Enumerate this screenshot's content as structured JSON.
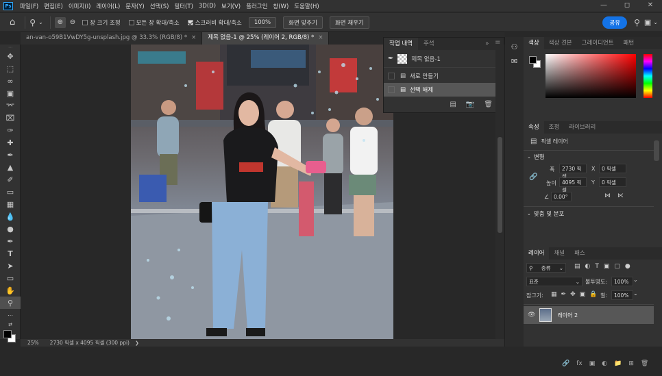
{
  "menu": {
    "app_logo": "Ps",
    "items": [
      "파일(F)",
      "편집(E)",
      "이미지(I)",
      "레이어(L)",
      "문자(Y)",
      "선택(S)",
      "필터(T)",
      "3D(D)",
      "보기(V)",
      "플러그인",
      "창(W)",
      "도움말(H)"
    ]
  },
  "options": {
    "zoom_fit": "창 크기 조정",
    "all_windows": "모든 창 확대/축소",
    "scrubby": "스크러비 확대/축소",
    "zoom_value": "100%",
    "fit_screen": "화면 맞추기",
    "fill_screen": "화면 채우기",
    "share": "공유"
  },
  "tabs": [
    {
      "label": "an-van-o59B1VwDY5g-unsplash.jpg @ 33.3% (RGB/8) *",
      "active": false
    },
    {
      "label": "제목 없음-1 @ 25% (레이어 2, RGB/8) *",
      "active": true
    }
  ],
  "history": {
    "tabs": [
      "작업 내역",
      "주석"
    ],
    "snapshot": "제목 없음-1",
    "items": [
      {
        "label": "새로 만들기",
        "selected": false
      },
      {
        "label": "선택 해제",
        "selected": true
      }
    ]
  },
  "status": {
    "zoom": "25%",
    "doc_info": "2730 픽셀 x 4095 픽셀 (300 ppi)"
  },
  "color_panel": {
    "tabs": [
      "색상",
      "색상 견본",
      "그레이디언트",
      "패턴"
    ]
  },
  "properties": {
    "tabs": [
      "속성",
      "조정",
      "라이브러리"
    ],
    "layer_type": "픽셀 레이어",
    "transform_title": "변형",
    "w_label": "폭",
    "w_value": "2730 픽셀",
    "x_label": "X",
    "x_value": "0 픽셀",
    "h_label": "높이",
    "h_value": "4095 픽셀",
    "y_label": "Y",
    "y_value": "0 픽셀",
    "angle_value": "0.00°",
    "align_title": "맞춤 및 분포"
  },
  "layers": {
    "tabs": [
      "레이어",
      "채널",
      "패스"
    ],
    "filter": "종류",
    "blend_mode": "표준",
    "opacity_label": "불투명도:",
    "opacity_value": "100%",
    "lock_label": "잠그기:",
    "fill_label": "칠:",
    "fill_value": "100%",
    "items": [
      {
        "name": "레이어 2",
        "visible": true
      }
    ]
  },
  "colors": {
    "accent": "#1473e6",
    "panel_bg": "#323232",
    "canvas_bg": "#282828"
  }
}
